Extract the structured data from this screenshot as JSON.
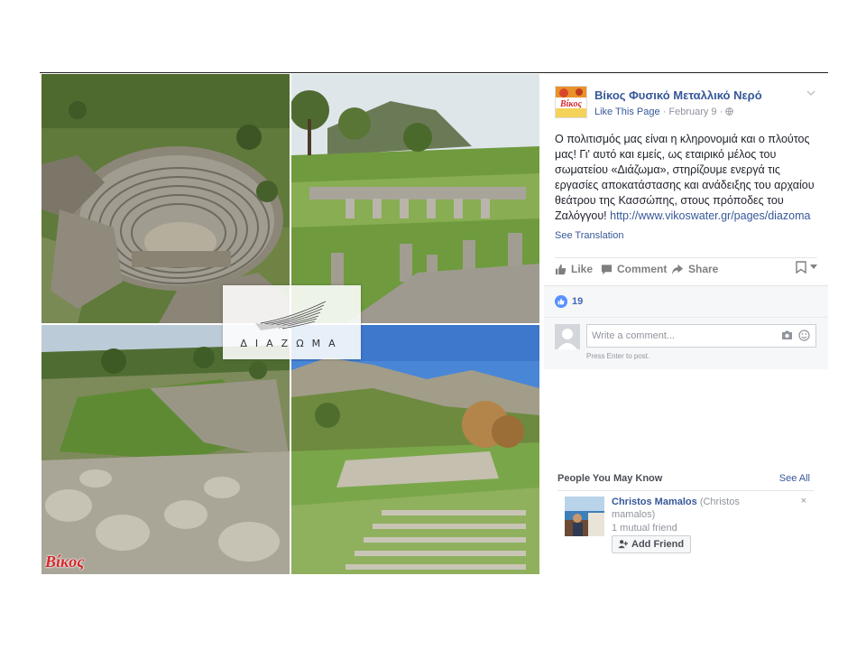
{
  "post": {
    "page_name": "Βίκος Φυσικό Μεταλλικό Νερό",
    "like_page": "Like This Page",
    "separator": " · ",
    "date": "February 9",
    "text_main": "Ο πολιτισμός μας είναι η κληρονομιά και ο πλούτος μας! Γι' αυτό και εμείς, ως εταιρικό μέλος του σωματείου «Διάζωμα», στηρίζουμε ενεργά τις εργασίες αποκατάστασης και ανάδειξης του αρχαίου θεάτρου της Κασσώπης, στους πρόποδες του Ζαλόγγου!",
    "link": "http://www.vikoswater.gr/pages/diazoma",
    "see_translation": "See Translation",
    "avatar_text": "Βίκος"
  },
  "collage": {
    "logo_text": "ΔΙΑΖΩΜΑ",
    "brand_mark": "Βίκος"
  },
  "actions": {
    "like": "Like",
    "comment": "Comment",
    "share": "Share"
  },
  "reactions": {
    "count": "19"
  },
  "comments": {
    "placeholder": "Write a comment...",
    "hint": "Press Enter to post."
  },
  "pymk": {
    "title": "People You May Know",
    "see_all": "See All",
    "friend_name": "Christos Mamalos",
    "friend_alias": "(Christos mamalos)",
    "mutual": "1 mutual friend",
    "add_friend": "Add Friend",
    "close": "×"
  },
  "colors": {
    "link_blue": "#365899",
    "like_blue": "#5890ff",
    "muted_gray": "#90949c",
    "brand_red": "#d8262d"
  },
  "icons": [
    "chevron-down-icon",
    "globe-icon",
    "like-icon",
    "comment-icon",
    "share-icon",
    "save-icon",
    "camera-icon",
    "emoji-icon",
    "add-friend-icon",
    "close-icon"
  ]
}
